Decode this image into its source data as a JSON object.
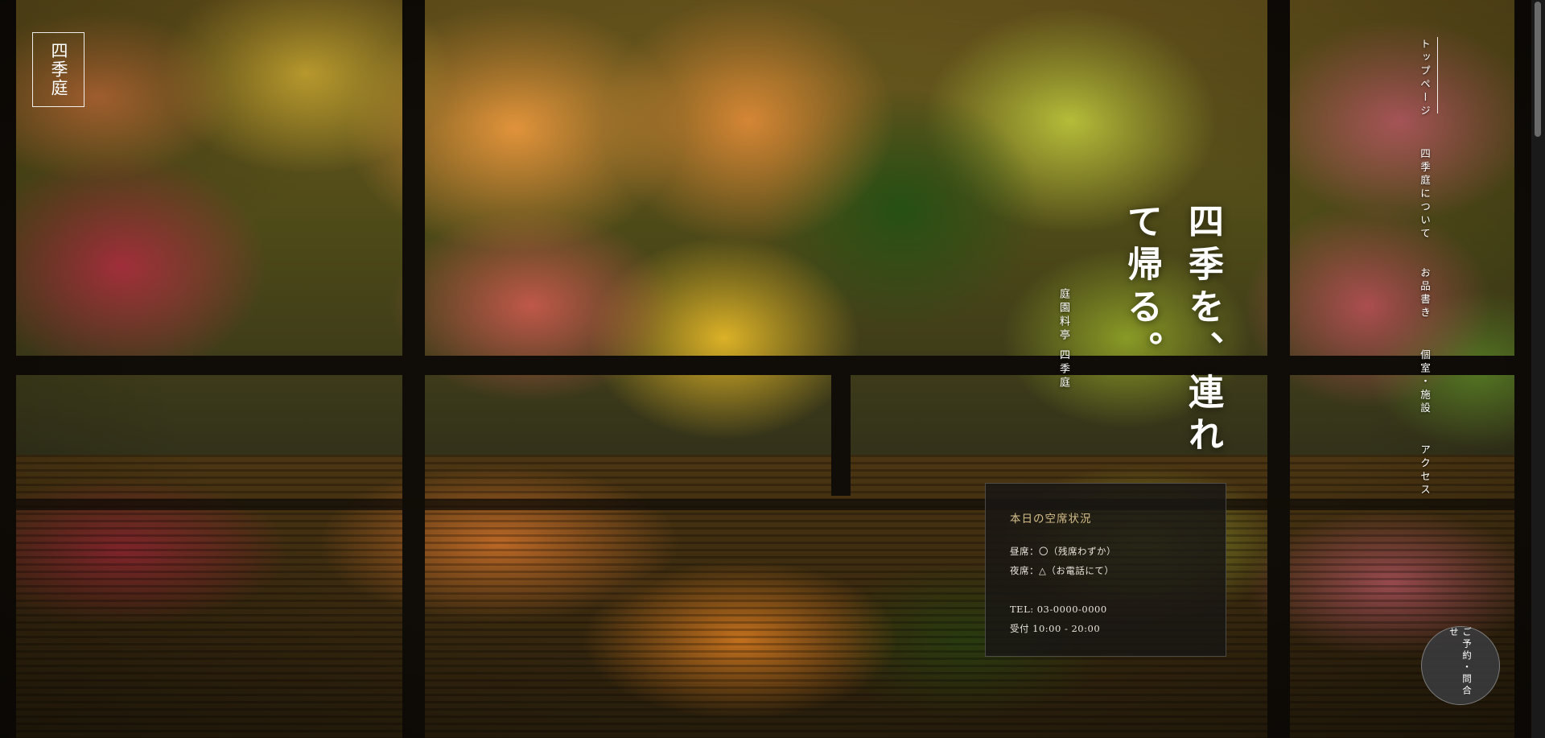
{
  "logo": {
    "text": "四季庭"
  },
  "hero": {
    "title": "四季を、連れて帰る。",
    "subtitle": "庭園料亭 四季庭"
  },
  "nav": {
    "items": [
      {
        "label": "トップページ",
        "active": true
      },
      {
        "label": "四季庭について",
        "active": false
      },
      {
        "label": "お品書き",
        "active": false
      },
      {
        "label": "個室・施設",
        "active": false
      },
      {
        "label": "アクセス",
        "active": false
      }
    ]
  },
  "status": {
    "title": "本日の空席状況",
    "lunch": "昼席：〇（残席わずか）",
    "dinner": "夜席：△（お電話にて）",
    "tel": "TEL: 03-0000-0000",
    "hours": "受付 10:00 - 20:00"
  },
  "reserve": {
    "label": "ご予約・問合せ"
  },
  "colors": {
    "panel_title": "#d6bf8a",
    "panel_bg": "#181614",
    "window_frame": "#100c07"
  }
}
